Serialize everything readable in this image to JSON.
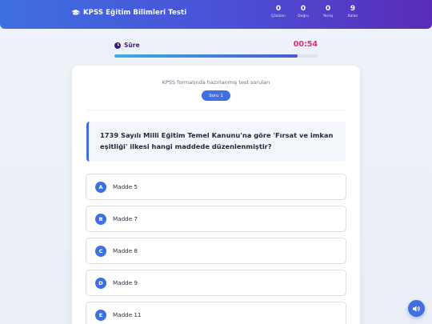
{
  "header": {
    "title": "KPSS Eğitim Bilimleri Testi",
    "icon": "graduation-cap-icon",
    "stats": [
      {
        "value": "0",
        "label": "Çözülen"
      },
      {
        "value": "0",
        "label": "Doğru"
      },
      {
        "value": "0",
        "label": "Yanlış"
      },
      {
        "value": "9",
        "label": "Kalan"
      }
    ]
  },
  "timer": {
    "label": "Süre",
    "value": "00:54",
    "progress_fraction": 0.9
  },
  "card": {
    "subtitle": "KPSS formatında hazırlanmış test soruları",
    "question_badge": "Soru 1",
    "question": "1739 Sayılı Milli Eğitim Temel Kanunu'na göre 'Fırsat ve imkan eşitliği' ilkesi hangi maddede düzenlenmiştir?",
    "options": [
      {
        "letter": "A",
        "text": "Madde 5"
      },
      {
        "letter": "B",
        "text": "Madde 7"
      },
      {
        "letter": "C",
        "text": "Madde 8"
      },
      {
        "letter": "D",
        "text": "Madde 9"
      },
      {
        "letter": "E",
        "text": "Madde 11"
      }
    ]
  },
  "colors": {
    "accent": "#3f6fe0",
    "header_end": "#5a2bb8",
    "timer_value": "#e0306d",
    "timer_label": "#3a1d7a"
  },
  "sound_button": {
    "icon": "speaker-icon"
  }
}
